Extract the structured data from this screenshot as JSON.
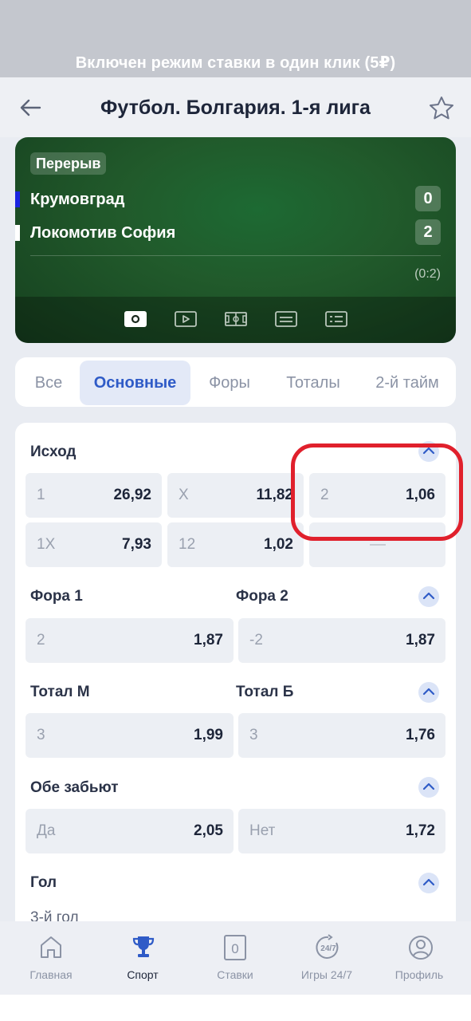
{
  "topbar": {
    "notice": "Включен режим ставки в один клик (5₽)"
  },
  "header": {
    "title": "Футбол. Болгария. 1-я лига",
    "back_icon": "arrow-left-icon",
    "favorite_icon": "star-icon"
  },
  "match": {
    "status": "Перерыв",
    "team1": {
      "name": "Крумовград",
      "score": "0",
      "color": "#1a24e0"
    },
    "team2": {
      "name": "Локомотив София",
      "score": "2",
      "color": "#ffffff"
    },
    "period_score": "(0:2)",
    "media_icons": [
      "scoreboard-icon",
      "video-icon",
      "field-icon",
      "stats-icon",
      "text-feed-icon"
    ]
  },
  "tabs": [
    {
      "label": "Все",
      "active": false
    },
    {
      "label": "Основные",
      "active": true
    },
    {
      "label": "Форы",
      "active": false
    },
    {
      "label": "Тоталы",
      "active": false
    },
    {
      "label": "2-й тайм",
      "active": false
    }
  ],
  "markets": {
    "outcome": {
      "title": "Исход",
      "odds": [
        {
          "label": "1",
          "value": "26,92"
        },
        {
          "label": "X",
          "value": "11,82"
        },
        {
          "label": "2",
          "value": "1,06"
        },
        {
          "label": "1X",
          "value": "7,93"
        },
        {
          "label": "12",
          "value": "1,02"
        },
        {
          "label": "",
          "value": ""
        }
      ]
    },
    "handicap": {
      "title1": "Фора 1",
      "title2": "Фора 2",
      "odds": [
        {
          "label": "2",
          "value": "1,87"
        },
        {
          "label": "-2",
          "value": "1,87"
        }
      ]
    },
    "total": {
      "title1": "Тотал М",
      "title2": "Тотал Б",
      "odds": [
        {
          "label": "3",
          "value": "1,99"
        },
        {
          "label": "3",
          "value": "1,76"
        }
      ]
    },
    "btts": {
      "title": "Обе забьют",
      "odds": [
        {
          "label": "Да",
          "value": "2,05"
        },
        {
          "label": "Нет",
          "value": "1,72"
        }
      ]
    },
    "goal": {
      "title": "Гол",
      "sub": "3-й гол"
    }
  },
  "nav": [
    {
      "label": "Главная",
      "icon": "home-icon"
    },
    {
      "label": "Спорт",
      "icon": "trophy-icon",
      "active": true
    },
    {
      "label": "Ставки",
      "icon": "bets-icon",
      "badge": "0"
    },
    {
      "label": "Игры 24/7",
      "icon": "games-icon",
      "badge": "24/7"
    },
    {
      "label": "Профиль",
      "icon": "profile-icon"
    }
  ],
  "colors": {
    "accent": "#2f5bc7",
    "highlight": "#e0202c"
  }
}
